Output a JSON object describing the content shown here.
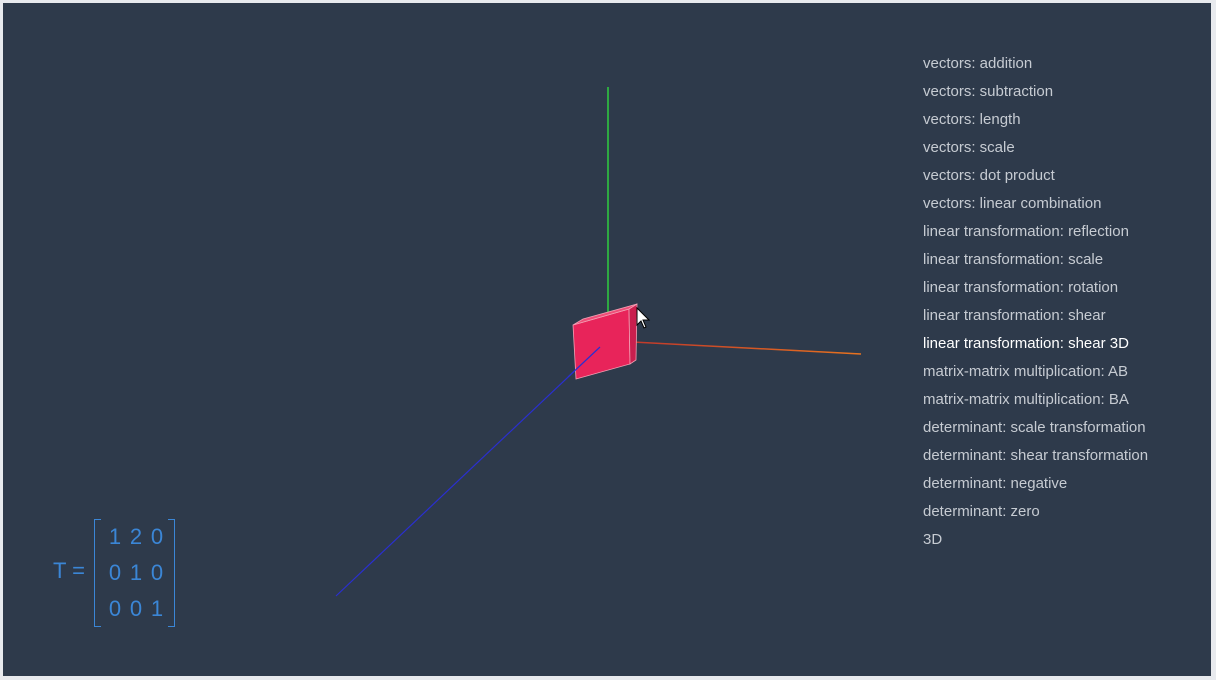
{
  "menu": {
    "items": [
      "vectors: addition",
      "vectors: subtraction",
      "vectors: length",
      "vectors: scale",
      "vectors: dot product",
      "vectors: linear combination",
      "linear transformation: reflection",
      "linear transformation: scale",
      "linear transformation: rotation",
      "linear transformation: shear",
      "linear transformation: shear 3D",
      "matrix-matrix multiplication: AB",
      "matrix-matrix multiplication: BA",
      "determinant: scale transformation",
      "determinant: shear transformation",
      "determinant: negative",
      "determinant: zero",
      "3D"
    ],
    "active_index": 10
  },
  "matrix": {
    "label": "T =",
    "rows": [
      [
        "1",
        "2",
        "0"
      ],
      [
        "0",
        "1",
        "0"
      ],
      [
        "0",
        "0",
        "1"
      ]
    ]
  },
  "colors": {
    "background": "#2e3a4b",
    "x_axis": "#e8731f",
    "y_axis": "#2ecc40",
    "z_axis": "#2a2fd0",
    "cube": "#e8245a",
    "matrix_text": "#3b86d6",
    "menu_text": "#c6cbd2",
    "menu_active": "#ffffff"
  }
}
